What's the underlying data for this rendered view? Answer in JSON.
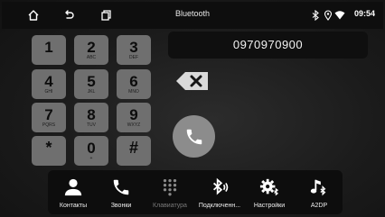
{
  "topbar": {
    "title": "Bluetooth",
    "time": "09:54",
    "icons": [
      "home-icon",
      "back-icon",
      "recent-apps-icon",
      "bluetooth-status-icon",
      "location-icon",
      "wifi-icon"
    ]
  },
  "display": {
    "number": "0970970900"
  },
  "keypad": {
    "keys": [
      {
        "digit": "1",
        "letters": ""
      },
      {
        "digit": "2",
        "letters": "ABC"
      },
      {
        "digit": "3",
        "letters": "DEF"
      },
      {
        "digit": "4",
        "letters": "GHI"
      },
      {
        "digit": "5",
        "letters": "JKL"
      },
      {
        "digit": "6",
        "letters": "MNO"
      },
      {
        "digit": "7",
        "letters": "PQRS"
      },
      {
        "digit": "8",
        "letters": "TUV"
      },
      {
        "digit": "9",
        "letters": "WXYZ"
      },
      {
        "digit": "*",
        "letters": ""
      },
      {
        "digit": "0",
        "letters": "+"
      },
      {
        "digit": "#",
        "letters": ""
      }
    ]
  },
  "actions": {
    "backspace_icon": "backspace-icon",
    "call_icon": "phone-icon"
  },
  "bottom_nav": [
    {
      "label": "Контакты",
      "icon": "contacts-icon",
      "active": true
    },
    {
      "label": "Звонки",
      "icon": "calls-icon",
      "active": true
    },
    {
      "label": "Клавиатура",
      "icon": "keypad-icon",
      "active": false
    },
    {
      "label": "Подключенн...",
      "icon": "bluetooth-audio-icon",
      "active": true
    },
    {
      "label": "Настройки",
      "icon": "settings-icon",
      "active": true
    },
    {
      "label": "A2DP",
      "icon": "music-bluetooth-icon",
      "active": true
    }
  ],
  "colors": {
    "key_bg": "#6f6f6f",
    "call_bg": "#8c8c8c",
    "bar_bg": "#0d0d0d"
  }
}
